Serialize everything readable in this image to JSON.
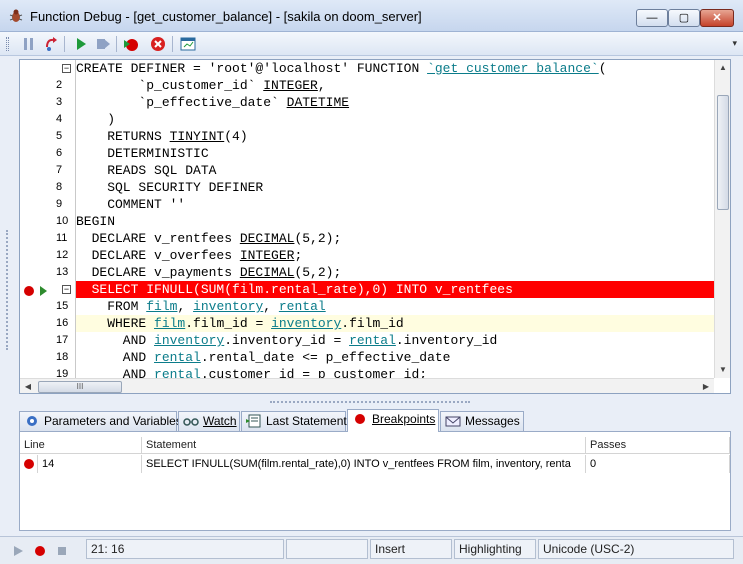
{
  "window": {
    "title": "Function Debug - [get_customer_balance] - [sakila on doom_server]",
    "minimize_glyph": "—",
    "maximize_glyph": "▢",
    "close_glyph": "✕"
  },
  "toolbar": {
    "buttons": [
      "pause-icon",
      "step-icon",
      "run-icon",
      "step-over-icon",
      "toggle-breakpoint-icon",
      "stop-icon",
      "window-icon"
    ],
    "more_glyph": "▾"
  },
  "editor": {
    "lines": [
      {
        "n": "",
        "text": "CREATE DEFINER = 'root'@'localhost' FUNCTION ",
        "ref": "`get_customer_balance`",
        "tail": "("
      },
      {
        "n": "2",
        "text": "        `p_customer_id` ",
        "ul": "INTEGER",
        "tail": ","
      },
      {
        "n": "3",
        "text": "        `p_effective_date` ",
        "ul": "DATETIME",
        "tail": ""
      },
      {
        "n": "4",
        "text": "    )",
        "ul": "",
        "tail": ""
      },
      {
        "n": "5",
        "text": "    RETURNS ",
        "ul": "TINYINT",
        "tail": "(4)"
      },
      {
        "n": "6",
        "text": "    DETERMINISTIC",
        "ul": "",
        "tail": ""
      },
      {
        "n": "7",
        "text": "    READS SQL DATA",
        "ul": "",
        "tail": ""
      },
      {
        "n": "8",
        "text": "    SQL SECURITY DEFINER",
        "ul": "",
        "tail": ""
      },
      {
        "n": "9",
        "text": "    COMMENT ''",
        "ul": "",
        "tail": ""
      },
      {
        "n": "10",
        "text": "BEGIN",
        "ul": "",
        "tail": ""
      },
      {
        "n": "11",
        "text": "  DECLARE v_rentfees ",
        "ul": "DECIMAL",
        "tail": "(5,2);"
      },
      {
        "n": "12",
        "text": "  DECLARE v_overfees ",
        "ul": "INTEGER",
        "tail": ";"
      },
      {
        "n": "13",
        "text": "  DECLARE v_payments ",
        "ul": "DECIMAL",
        "tail": "(5,2);"
      },
      {
        "n": "",
        "text": "  SELECT IFNULL(SUM(film.rental_rate),0) INTO v_rentfees"
      },
      {
        "n": "15",
        "text": "    FROM film, inventory, rental"
      },
      {
        "n": "16",
        "text": "    WHERE film.film_id = inventory.film_id"
      },
      {
        "n": "17",
        "text": "      AND inventory.inventory_id = rental.inventory_id"
      },
      {
        "n": "18",
        "text": "      AND rental.rental_date <= p_effective_date"
      },
      {
        "n": "19",
        "text": "      AND rental.customer_id = p_customer_id;"
      }
    ],
    "fold_glyph": "−",
    "scroll_up": "▲",
    "scroll_down": "▼",
    "scroll_left": "◀",
    "scroll_right": "▶",
    "hthumb_grip": "III"
  },
  "tabs": [
    {
      "label": "Parameters and Variables",
      "icon": "parameters-icon"
    },
    {
      "label": "Watch",
      "icon": "glasses-icon"
    },
    {
      "label": "Last Statement",
      "icon": "statement-icon"
    },
    {
      "label": "Breakpoints",
      "icon": "breakpoint-icon",
      "active": true
    },
    {
      "label": "Messages",
      "icon": "envelope-icon"
    }
  ],
  "breakpoints": {
    "columns": [
      "Line",
      "Statement",
      "Passes"
    ],
    "rows": [
      {
        "line": "14",
        "statement": "SELECT IFNULL(SUM(film.rental_rate),0) INTO v_rentfees    FROM film, inventory, renta",
        "passes": "0"
      }
    ]
  },
  "status": {
    "position": "21:   16",
    "mode": "Insert",
    "highlighting": "Highlighting",
    "encoding": "Unicode (USC-2)"
  },
  "colors": {
    "breakpoint_line": "#ff0000",
    "current_line": "#fffde0",
    "reference": "#0b7c8a"
  }
}
